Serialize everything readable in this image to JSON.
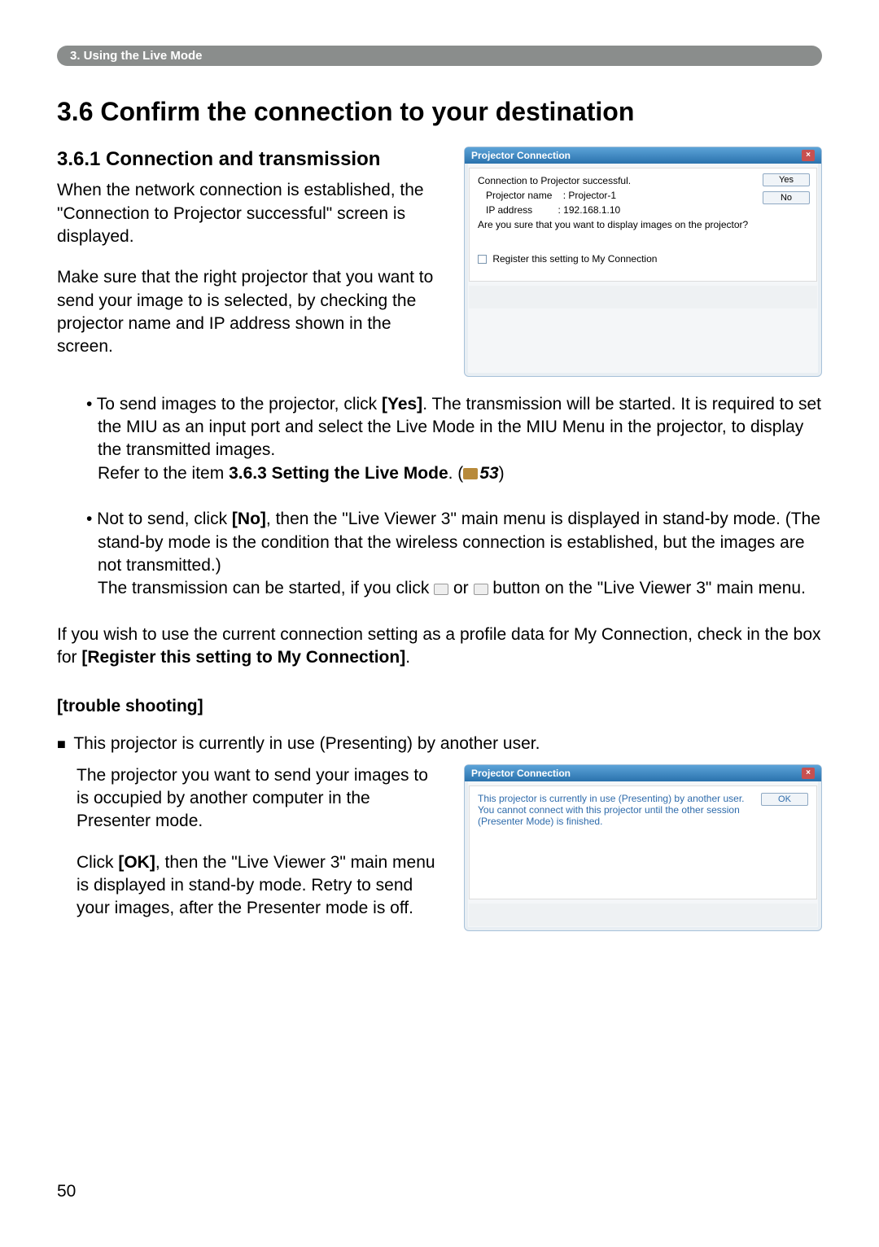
{
  "breadcrumb": "3. Using the Live Mode",
  "h1": "3.6 Confirm the connection to your destination",
  "h2": "3.6.1 Connection and transmission",
  "p1": "When the network connection is established, the \"Connection to Projector successful\" screen is displayed.",
  "p2": "Make sure that the right projector that you want to send your image to is selected, by checking the projector name and IP address shown in the screen.",
  "dialog1": {
    "title": "Projector Connection",
    "close": "×",
    "line1": "Connection to Projector successful.",
    "line2a": "Projector name",
    "line2b": ":  Projector-1",
    "line3a": "IP address",
    "line3b": ":  192.168.1.10",
    "line4": "Are you sure that you want to display images on the projector?",
    "checkbox": "Register this setting to My Connection",
    "yes": "Yes",
    "no": "No"
  },
  "bullet1a": "• To send images to the projector, click ",
  "bullet1b": "[Yes]",
  "bullet1c": ". The transmission will be started. It is required to set the MIU as an input port and select the Live Mode in the MIU Menu in the projector, to display the transmitted images.",
  "bullet1d": "Refer to the item ",
  "bullet1e": "3.6.3 Setting the Live Mode",
  "bullet1f": ". (",
  "bullet1g": "53",
  "bullet1h": ")",
  "bullet2a": "• Not to send, click ",
  "bullet2b": "[No]",
  "bullet2c": ", then the \"Live Viewer 3\" main menu is displayed in stand-by mode. (The stand-by mode is the condition that the wireless connection is established, but the images are not transmitted.)",
  "bullet2d": "The transmission can be started, if you click ",
  "bullet2e": " or ",
  "bullet2f": " button on the \"Live Viewer 3\" main menu.",
  "p3a": "If you wish to use the current connection setting as a profile data for My Connection, check in the box for ",
  "p3b": "[Register this setting to My Connection]",
  "p3c": ".",
  "trouble": "[trouble shooting]",
  "ts_line": " This projector is currently in use (Presenting) by another user.",
  "ts_p1": "The projector you want to send your images to is occupied by another computer in the Presenter mode.",
  "ts_p2a": "Click ",
  "ts_p2b": "[OK]",
  "ts_p2c": ", then the \"Live Viewer 3\" main menu is displayed in stand-by mode. Retry to send your images, after the Presenter mode is off.",
  "dialog2": {
    "title": "Projector Connection",
    "close": "×",
    "body": "This projector is currently in use (Presenting) by another user. You cannot connect with this projector until the other session (Presenter Mode) is finished.",
    "ok": "OK"
  },
  "page": "50"
}
